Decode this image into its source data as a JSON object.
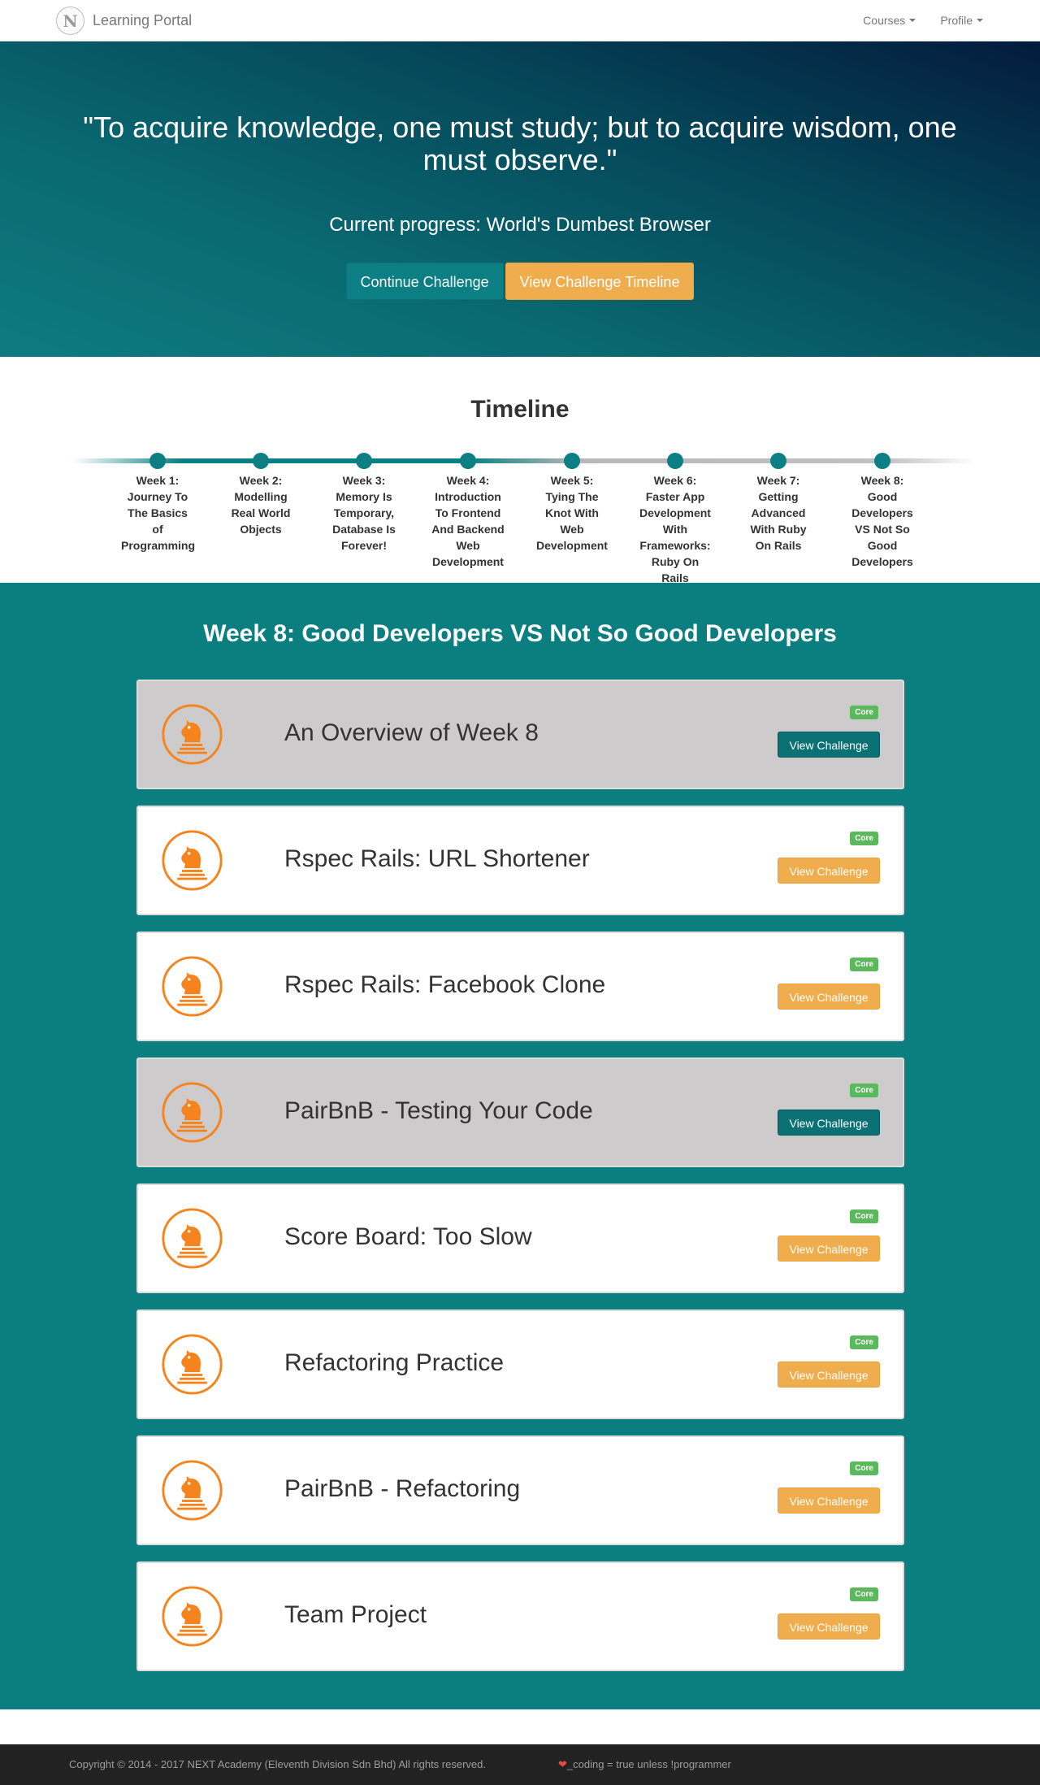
{
  "navbar": {
    "logo_letter": "N",
    "brand": "Learning Portal",
    "menu": [
      {
        "label": "Courses"
      },
      {
        "label": "Profile"
      }
    ]
  },
  "hero": {
    "quote": "\"To acquire knowledge, one must study; but to acquire wisdom, one must observe.\"",
    "progress": "Current progress: World's Dumbest Browser",
    "continue_label": "Continue Challenge",
    "timeline_label": "View Challenge Timeline"
  },
  "timeline": {
    "title": "Timeline",
    "steps": [
      {
        "label": "Week 1: Journey To The Basics of Programming"
      },
      {
        "label": "Week 2: Modelling Real World Objects"
      },
      {
        "label": "Week 3: Memory Is Temporary, Database Is Forever!"
      },
      {
        "label": "Week 4: Introduction To Frontend And Backend Web Development"
      },
      {
        "label": "Week 5: Tying The Knot With Web Development"
      },
      {
        "label": "Week 6: Faster App Development With Frameworks: Ruby On Rails"
      },
      {
        "label": "Week 7: Getting Advanced With Ruby On Rails"
      },
      {
        "label": "Week 8: Good Developers VS Not So Good Developers"
      }
    ]
  },
  "week": {
    "title": "Week 8: Good Developers VS Not So Good Developers",
    "challenges": [
      {
        "title": "An Overview of Week 8",
        "badge": "Core",
        "button": "View Challenge"
      },
      {
        "title": "Rspec Rails: URL Shortener",
        "badge": "Core",
        "button": "View Challenge"
      },
      {
        "title": "Rspec Rails: Facebook Clone",
        "badge": "Core",
        "button": "View Challenge"
      },
      {
        "title": "PairBnB - Testing Your Code",
        "badge": "Core",
        "button": "View Challenge"
      },
      {
        "title": "Score Board: Too Slow",
        "badge": "Core",
        "button": "View Challenge"
      },
      {
        "title": "Refactoring Practice",
        "badge": "Core",
        "button": "View Challenge"
      },
      {
        "title": "PairBnB - Refactoring",
        "badge": "Core",
        "button": "View Challenge"
      },
      {
        "title": "Team Project",
        "badge": "Core",
        "button": "View Challenge"
      }
    ]
  },
  "footer": {
    "copyright": "Copyright © 2014 - 2017 NEXT Academy (Eleventh Division Sdn Bhd) All rights reserved.",
    "heart": "❤",
    "motto": "_coding = true unless !programmer"
  },
  "colors": {
    "teal": "#0b7f83",
    "orange": "#f0ad4e",
    "badge_green": "#5cb85c",
    "icon_orange": "#f5841f",
    "footer_bg": "#222222"
  },
  "icons": {
    "challenge": "chess-knight-icon",
    "dropdown": "caret-down-icon"
  }
}
